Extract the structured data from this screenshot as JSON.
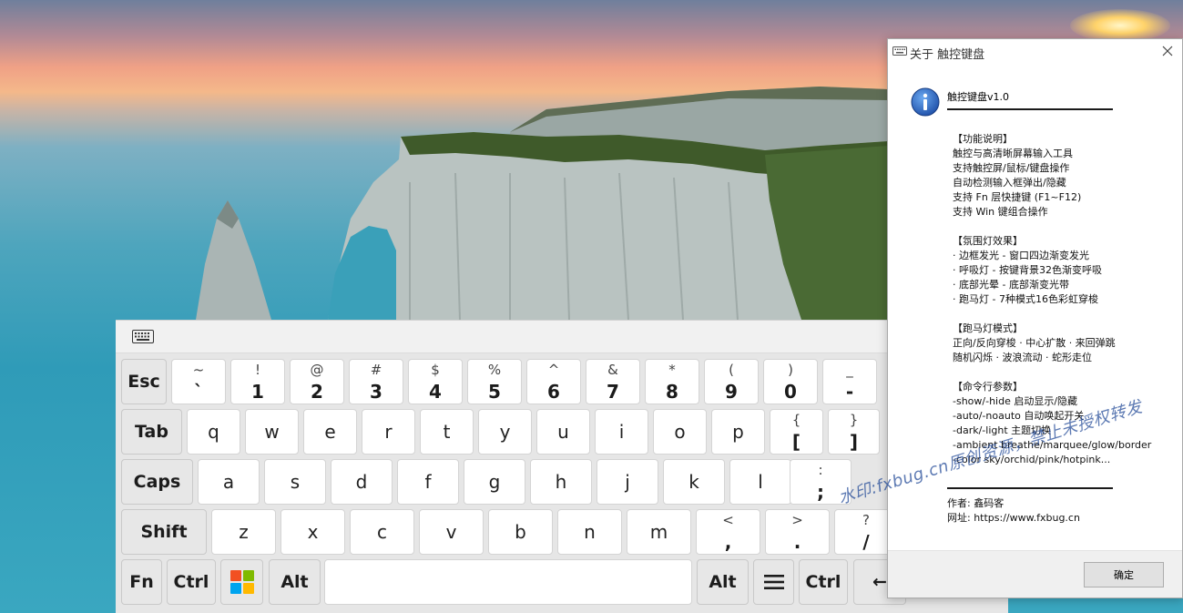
{
  "colors": {
    "dialog_accent_icon": "#1e5fbf",
    "key_bg": "#ffffff",
    "modifier_key_bg": "#e7e7e7",
    "keyboard_bg": "#e6e6e6",
    "win_logo": [
      "#f25022",
      "#7fba00",
      "#00a4ef",
      "#ffb900"
    ]
  },
  "keyboard": {
    "titlebar_icon": "keyboard-icon",
    "rows": [
      {
        "keys": [
          {
            "type": "mod",
            "label": "Esc"
          },
          {
            "type": "dual",
            "top": "~",
            "bottom": "`"
          },
          {
            "type": "dual",
            "top": "!",
            "bottom": "1"
          },
          {
            "type": "dual",
            "top": "@",
            "bottom": "2"
          },
          {
            "type": "dual",
            "top": "#",
            "bottom": "3"
          },
          {
            "type": "dual",
            "top": "$",
            "bottom": "4"
          },
          {
            "type": "dual",
            "top": "%",
            "bottom": "5"
          },
          {
            "type": "dual",
            "top": "^",
            "bottom": "6"
          },
          {
            "type": "dual",
            "top": "&",
            "bottom": "7"
          },
          {
            "type": "dual",
            "top": "*",
            "bottom": "8"
          },
          {
            "type": "dual",
            "top": "(",
            "bottom": "9"
          },
          {
            "type": "dual",
            "top": ")",
            "bottom": "0"
          },
          {
            "type": "dual",
            "top": "_",
            "bottom": "-"
          }
        ]
      },
      {
        "keys": [
          {
            "type": "mod",
            "label": "Tab"
          },
          {
            "type": "char",
            "label": "q"
          },
          {
            "type": "char",
            "label": "w"
          },
          {
            "type": "char",
            "label": "e"
          },
          {
            "type": "char",
            "label": "r"
          },
          {
            "type": "char",
            "label": "t"
          },
          {
            "type": "char",
            "label": "y"
          },
          {
            "type": "char",
            "label": "u"
          },
          {
            "type": "char",
            "label": "i"
          },
          {
            "type": "char",
            "label": "o"
          },
          {
            "type": "char",
            "label": "p"
          },
          {
            "type": "dual",
            "top": "{",
            "bottom": "["
          },
          {
            "type": "dual",
            "top": "}",
            "bottom": "]"
          }
        ]
      },
      {
        "keys": [
          {
            "type": "mod",
            "label": "Caps"
          },
          {
            "type": "char",
            "label": "a"
          },
          {
            "type": "char",
            "label": "s"
          },
          {
            "type": "char",
            "label": "d"
          },
          {
            "type": "char",
            "label": "f"
          },
          {
            "type": "char",
            "label": "g"
          },
          {
            "type": "char",
            "label": "h"
          },
          {
            "type": "char",
            "label": "j"
          },
          {
            "type": "char",
            "label": "k"
          },
          {
            "type": "char",
            "label": "l"
          },
          {
            "type": "dual",
            "top": ":",
            "bottom": ";"
          }
        ]
      },
      {
        "keys": [
          {
            "type": "mod",
            "label": "Shift"
          },
          {
            "type": "char",
            "label": "z"
          },
          {
            "type": "char",
            "label": "x"
          },
          {
            "type": "char",
            "label": "c"
          },
          {
            "type": "char",
            "label": "v"
          },
          {
            "type": "char",
            "label": "b"
          },
          {
            "type": "char",
            "label": "n"
          },
          {
            "type": "char",
            "label": "m"
          },
          {
            "type": "dual",
            "top": "<",
            "bottom": ","
          },
          {
            "type": "dual",
            "top": ">",
            "bottom": "."
          },
          {
            "type": "dual",
            "top": "?",
            "bottom": "/"
          }
        ]
      },
      {
        "keys": [
          {
            "type": "mod",
            "label": "Fn"
          },
          {
            "type": "mod",
            "label": "Ctrl"
          },
          {
            "type": "win",
            "icon": "windows-logo-icon"
          },
          {
            "type": "mod",
            "label": "Alt"
          },
          {
            "type": "space",
            "label": ""
          },
          {
            "type": "mod",
            "label": "Alt"
          },
          {
            "type": "menu",
            "icon": "menu-icon"
          },
          {
            "type": "mod",
            "label": "Ctrl"
          },
          {
            "type": "mod",
            "label": "←"
          }
        ]
      }
    ]
  },
  "dialog": {
    "title": "关于 触控键盘",
    "app_icon": "keyboard-icon",
    "close_icon": "close-icon",
    "info_icon": "info-icon",
    "product": "触控键盘v1.0",
    "body_lines": [
      "【功能说明】",
      "触控与高清晰屏幕输入工具",
      "支持触控屏/鼠标/键盘操作",
      "自动检测输入框弹出/隐藏",
      "支持 Fn 层快捷键 (F1~F12)",
      "支持 Win 键组合操作",
      "",
      "【氛围灯效果】",
      "· 边框发光 - 窗口四边渐变发光",
      "· 呼吸灯 - 按键背景32色渐变呼吸",
      "· 底部光晕 - 底部渐变光带",
      "· 跑马灯 - 7种模式16色彩虹穿梭",
      "",
      "【跑马灯模式】",
      "正向/反向穿梭 · 中心扩散 · 来回弹跳",
      "随机闪烁 · 波浪流动 · 蛇形走位",
      "",
      "【命令行参数】",
      "-show/-hide  启动显示/隐藏",
      "-auto/-noauto 自动唤起开关",
      "-dark/-light  主题切换",
      "-ambient breathe/marquee/glow/border",
      "-color sky/orchid/pink/hotpink..."
    ],
    "author": "作者: 鑫码客",
    "website": "网址: https://www.fxbug.cn",
    "ok_label": "确定"
  },
  "watermark": "水印:fxbug.cn原创资源，禁止未授权转发"
}
